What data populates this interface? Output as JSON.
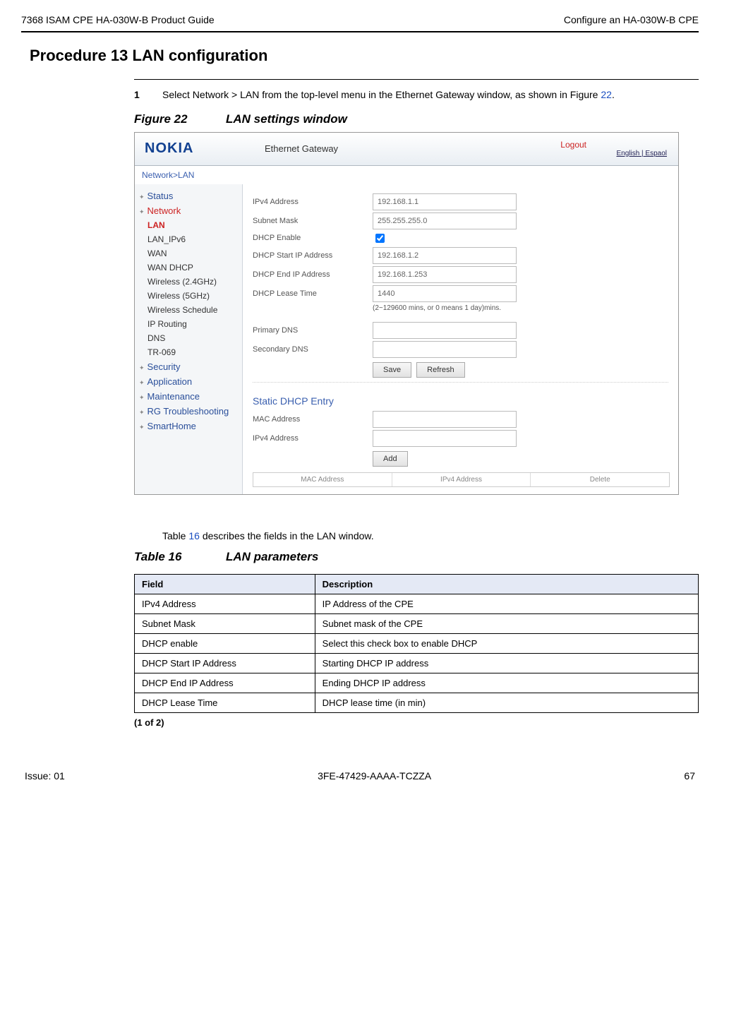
{
  "header": {
    "left": "7368 ISAM CPE HA-030W-B Product Guide",
    "right": "Configure an HA-030W-B CPE"
  },
  "procedure_title": "Procedure 13     LAN configuration",
  "step": {
    "num": "1",
    "text_before": "Select Network > LAN from the top-level menu in the Ethernet Gateway window, as shown in Figure ",
    "link": "22",
    "text_after": "."
  },
  "figure": {
    "label": "Figure 22",
    "title": "LAN settings window"
  },
  "screenshot": {
    "logo": "NOKIA",
    "title": "Ethernet Gateway",
    "logout": "Logout",
    "lang": "English | Espaol",
    "crumb": "Network>LAN",
    "sidebar": {
      "status": "Status",
      "network": "Network",
      "lan": "LAN",
      "lan_ipv6": "LAN_IPv6",
      "wan": "WAN",
      "wan_dhcp": "WAN DHCP",
      "w24": "Wireless (2.4GHz)",
      "w5": "Wireless (5GHz)",
      "wsched": "Wireless Schedule",
      "iproute": "IP Routing",
      "dns": "DNS",
      "tr069": "TR-069",
      "security": "Security",
      "application": "Application",
      "maintenance": "Maintenance",
      "rgtrouble": "RG Troubleshooting",
      "smarthome": "SmartHome"
    },
    "labels": {
      "ipv4": "IPv4 Address",
      "mask": "Subnet Mask",
      "dhcp_enable": "DHCP Enable",
      "dhcp_start": "DHCP Start IP Address",
      "dhcp_end": "DHCP End IP Address",
      "lease": "DHCP Lease Time",
      "lease_hint": "(2~129600 mins, or 0 means 1 day)mins.",
      "pdns": "Primary DNS",
      "sdns": "Secondary DNS",
      "save": "Save",
      "refresh": "Refresh",
      "static_hd": "Static DHCP Entry",
      "mac": "MAC Address",
      "ipv4b": "IPv4 Address",
      "add": "Add",
      "col_mac": "MAC Address",
      "col_ip": "IPv4 Address",
      "col_del": "Delete"
    },
    "values": {
      "ipv4": "192.168.1.1",
      "mask": "255.255.255.0",
      "dhcp_start": "192.168.1.2",
      "dhcp_end": "192.168.1.253",
      "lease": "1440",
      "pdns": "",
      "sdns": "",
      "mac": "",
      "ipv4b": ""
    }
  },
  "table_desc": {
    "before": "Table ",
    "link": "16",
    "after": " describes the fields in the LAN window."
  },
  "table_caption": {
    "label": "Table 16",
    "title": "LAN parameters"
  },
  "param_table": {
    "h1": "Field",
    "h2": "Description",
    "rows": [
      {
        "f": "IPv4 Address",
        "d": "IP Address of the CPE"
      },
      {
        "f": "Subnet Mask",
        "d": "Subnet mask of the CPE"
      },
      {
        "f": "DHCP enable",
        "d": "Select this check box to enable DHCP"
      },
      {
        "f": "DHCP Start IP Address",
        "d": "Starting DHCP IP address"
      },
      {
        "f": "DHCP End IP Address",
        "d": "Ending DHCP IP address"
      },
      {
        "f": "DHCP Lease Time",
        "d": "DHCP lease time (in min)"
      }
    ]
  },
  "pagenote": "(1 of 2)",
  "footer": {
    "left": "Issue: 01",
    "center": "3FE-47429-AAAA-TCZZA",
    "right": "67"
  }
}
